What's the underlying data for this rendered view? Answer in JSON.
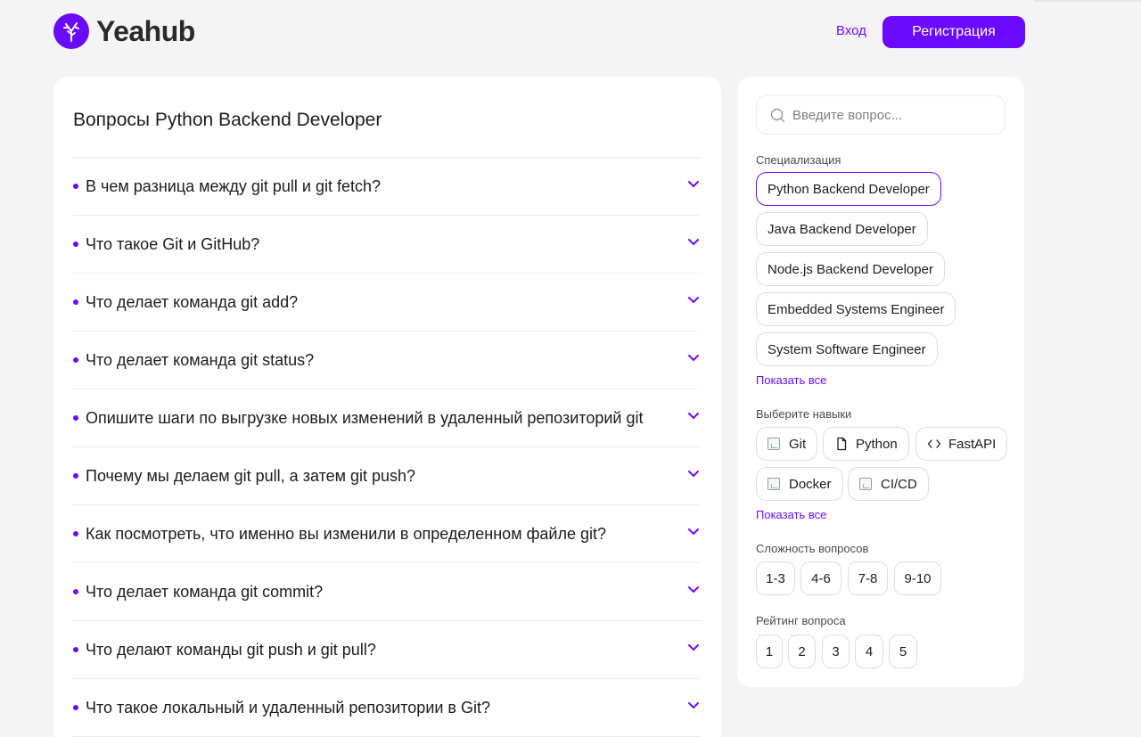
{
  "header": {
    "logo_text": "Yeahub",
    "login_label": "Вход",
    "register_label": "Регистрация"
  },
  "main": {
    "title": "Вопросы Python Backend Developer",
    "questions": [
      "В чем разница между git pull и git fetch?",
      "Что такое Git и GitHub?",
      "Что делает команда git add?",
      "Что делает команда git status?",
      "Опишите шаги по выгрузке новых изменений в удаленный репозиторий git",
      "Почему мы делаем git pull, а затем git push?",
      "Как посмотреть, что именно вы изменили в определенном файле git?",
      "Что делает команда git commit?",
      "Что делают команды git push и git pull?",
      "Что такое локальный и удаленный репозитории в Git?"
    ]
  },
  "sidebar": {
    "search_placeholder": "Введите вопрос...",
    "specialization_label": "Специализация",
    "specializations": [
      "Python Backend Developer",
      "Java Backend Developer",
      "Node.js Backend Developer",
      "Embedded Systems Engineer",
      "System Software Engineer"
    ],
    "show_all_label": "Показать все",
    "skills_label": "Выберите навыки",
    "skills": [
      "Git",
      "Python",
      "FastAPI",
      "Docker",
      "CI/CD"
    ],
    "show_all_skills_label": "Показать все",
    "difficulty_label": "Сложность вопросов",
    "difficulty": [
      "1-3",
      "4-6",
      "7-8",
      "9-10"
    ],
    "rating_label": "Рейтинг вопроса",
    "rating": [
      "1",
      "2",
      "3",
      "4",
      "5"
    ]
  },
  "colors": {
    "accent": "#6a0bff",
    "background": "#f4f4f4",
    "card": "#ffffff"
  }
}
